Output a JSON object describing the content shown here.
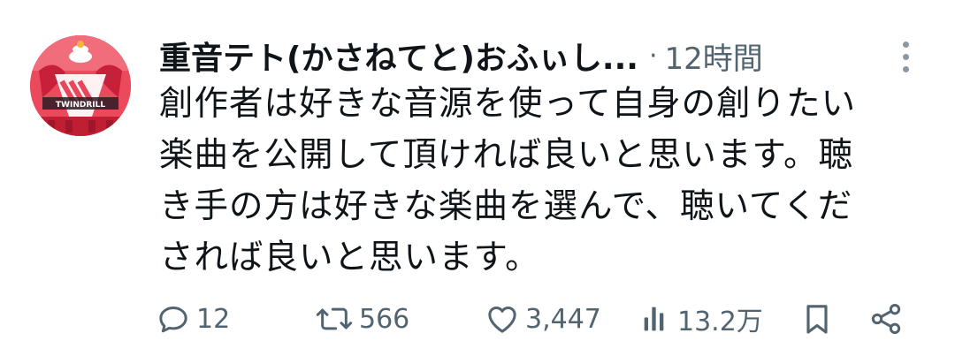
{
  "user": {
    "display_name": "重音テト(かさねてと)おふぃし...",
    "separator": "·",
    "timestamp": "12時間"
  },
  "tweet": {
    "lines": [
      "創作者は好きな音源を使って自身の創りたい",
      "楽曲を公開して頂ければ良いと思います。聴",
      "き手の方は好きな楽曲を選んで、聴いてくだ",
      "されば良いと思います。"
    ]
  },
  "actions": {
    "reply_count": "12",
    "retweet_count": "566",
    "like_count": "3,447",
    "view_count": "13.2万"
  },
  "icons": {
    "more": "more-vertical-icon",
    "reply": "reply-icon",
    "retweet": "retweet-icon",
    "like": "heart-icon",
    "views": "views-icon",
    "bookmark": "bookmark-icon",
    "share": "share-icon"
  },
  "colors": {
    "text": "#0f1419",
    "muted": "#536471",
    "avatar_bg": "#e8465a"
  }
}
